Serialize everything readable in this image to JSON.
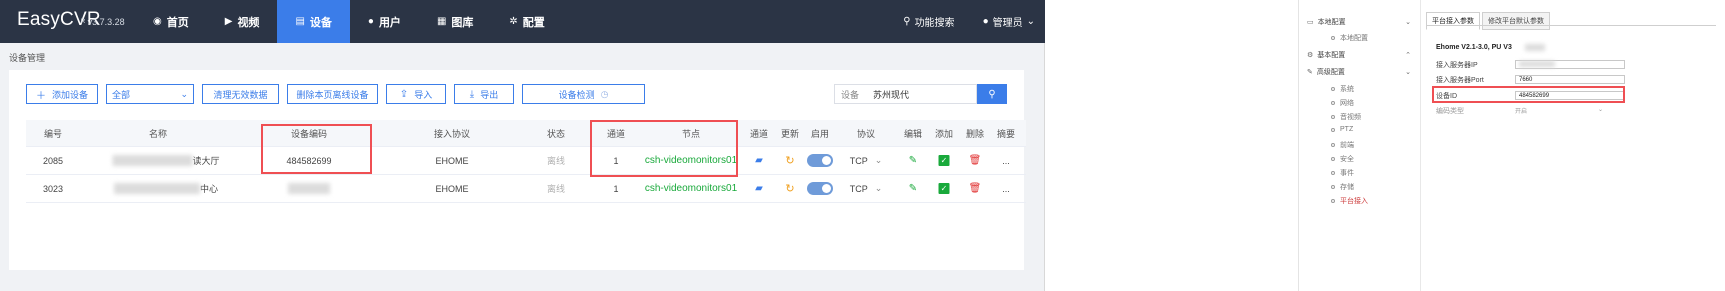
{
  "app": {
    "brand": "EasyCVR",
    "version": "v3.7.3.28"
  },
  "nav": [
    {
      "label": "首页",
      "icon": "dashboard-icon",
      "glyph": "◉"
    },
    {
      "label": "视频",
      "icon": "play-circle-icon",
      "glyph": "▶"
    },
    {
      "label": "设备",
      "icon": "device-list-icon",
      "glyph": "▤"
    },
    {
      "label": "用户",
      "icon": "user-icon",
      "glyph": "●"
    },
    {
      "label": "图库",
      "icon": "gallery-icon",
      "glyph": "▦"
    },
    {
      "label": "配置",
      "icon": "gear-icon",
      "glyph": "✲"
    }
  ],
  "top_right": {
    "search_label": "功能搜索",
    "user_label": "管理员"
  },
  "breadcrumb": "设备管理",
  "toolbar": {
    "add_device": "添加设备",
    "filter_value": "全部",
    "clear_invalid": "清理无效数据",
    "delete_offline": "删除本页离线设备",
    "import": "导入",
    "export": "导出",
    "device_check": "设备检测"
  },
  "search": {
    "label": "设备",
    "value": "苏州现代"
  },
  "table": {
    "headers": [
      "编号",
      "名称",
      "设备编码",
      "接入协议",
      "状态",
      "通道",
      "节点",
      "通道",
      "更新",
      "启用",
      "协议",
      "编辑",
      "添加",
      "删除",
      "摘要"
    ],
    "rows": [
      {
        "id": "2085",
        "name_suffix": "读大厅",
        "code": "484582699",
        "protocol": "EHOME",
        "status": "离线",
        "channel": "1",
        "node": "csh-videomonitors01",
        "transport": "TCP",
        "more": "..."
      },
      {
        "id": "3023",
        "name_suffix": "中心",
        "code": "",
        "protocol": "EHOME",
        "status": "离线",
        "channel": "1",
        "node": "csh-videomonitors01",
        "transport": "TCP",
        "more": "..."
      }
    ]
  },
  "config_panel": {
    "sidebar": [
      {
        "label": "本地配置",
        "icon": "monitor-icon"
      },
      {
        "label": "本地配置",
        "sub": true
      },
      {
        "label": "基本配置",
        "icon": "settings-icon"
      },
      {
        "label": "高级配置",
        "icon": "wrench-icon"
      },
      {
        "label": "系统",
        "sub": true
      },
      {
        "label": "网络",
        "sub": true
      },
      {
        "label": "音视频",
        "sub": true
      },
      {
        "label": "PTZ",
        "sub": true
      },
      {
        "label": "前端",
        "sub": true
      },
      {
        "label": "安全",
        "sub": true
      },
      {
        "label": "事件",
        "sub": true
      },
      {
        "label": "存储",
        "sub": true
      },
      {
        "label": "平台接入",
        "sub": true,
        "active": true
      }
    ],
    "tabs": [
      "平台接入参数",
      "修改平台默认参数"
    ],
    "title": "Ehome V2.1-3.0, PU V3",
    "fields": [
      {
        "label": "接入服务器IP",
        "value": ""
      },
      {
        "label": "接入服务器Port",
        "value": "7660"
      },
      {
        "label": "设备ID",
        "value": "484582699"
      },
      {
        "label": "编码类型",
        "value": "开启"
      }
    ]
  }
}
